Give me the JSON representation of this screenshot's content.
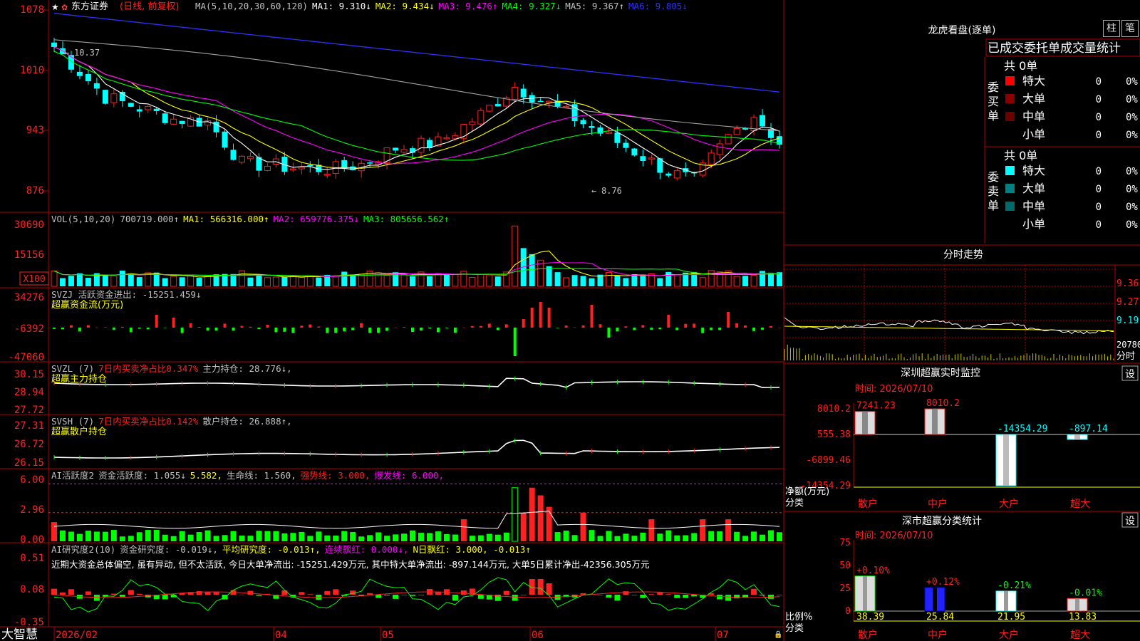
{
  "app": {
    "name": "大智慧"
  },
  "stock": {
    "name": "东方证券",
    "mode": "(日线, 前复权)"
  },
  "colors": {
    "up": "#ff2020",
    "down": "#00ffff",
    "frame": "#b00000",
    "ma1": "#ffffff",
    "ma2": "#ffff00",
    "ma3": "#ff00ff",
    "ma4": "#00ff00",
    "ma5": "#a0a0a0",
    "ma6": "#3030ff",
    "green": "#00ff00"
  },
  "price_panel": {
    "axis_ticks": [
      "1078",
      "1010",
      "943",
      "876"
    ],
    "legend": [
      {
        "t": "MA(5,10,20,30,60,120)",
        "c": "#c0c0c0"
      },
      {
        "t": "MA1: 9.310↓",
        "c": "#ffffff"
      },
      {
        "t": "MA2: 9.434↓",
        "c": "#ffff00"
      },
      {
        "t": "MA3: 9.476↑",
        "c": "#ff00ff"
      },
      {
        "t": "MA4: 9.327↓",
        "c": "#00ff00"
      },
      {
        "t": "MA5: 9.367↑",
        "c": "#c0c0c0"
      },
      {
        "t": "MA6: 9.805↓",
        "c": "#3030ff"
      }
    ],
    "hi_label": "10.37",
    "lo_label": "8.76"
  },
  "vol_panel": {
    "axis_ticks": [
      "30690",
      "15156"
    ],
    "unit": "X100",
    "legend": [
      {
        "t": "VOL(5,10,20)",
        "c": "#c0c0c0"
      },
      {
        "t": "700719.000↑",
        "c": "#c0c0c0"
      },
      {
        "t": "MA1: 566316.000↑",
        "c": "#ffff00"
      },
      {
        "t": "MA2: 659776.375↓",
        "c": "#ff00ff"
      },
      {
        "t": "MA3: 805656.562↑",
        "c": "#00ff00"
      }
    ]
  },
  "svzj_panel": {
    "axis_ticks": [
      "34276",
      "-6392",
      "-47060"
    ],
    "legend": [
      {
        "t": "SVZJ  活跃资金进出: -15251.459↓",
        "c": "#c0c0c0"
      }
    ],
    "sub": "超赢资金流(万元)"
  },
  "svzl_panel": {
    "axis_ticks": [
      "30.15",
      "28.94",
      "27.72"
    ],
    "legend": [
      {
        "t": "SVZL (7)",
        "c": "#c0c0c0"
      },
      {
        "t": "7日内买卖净占比0.347%",
        "c": "#ff2020"
      },
      {
        "t": "主力持仓: 28.776↓,",
        "c": "#c0c0c0"
      }
    ],
    "sub": "超赢主力持仓"
  },
  "svsh_panel": {
    "axis_ticks": [
      "27.31",
      "26.72",
      "26.15"
    ],
    "legend": [
      {
        "t": "SVSH (7)",
        "c": "#c0c0c0"
      },
      {
        "t": "7日内买卖净占比0.142%",
        "c": "#ff2020"
      },
      {
        "t": "散户持仓: 26.888↑,",
        "c": "#c0c0c0"
      }
    ],
    "sub": "超赢散户持仓"
  },
  "ai_active_panel": {
    "axis_ticks": [
      "6.00",
      "2.96",
      "0.00"
    ],
    "legend": [
      {
        "t": "AI活跃度2",
        "c": "#c0c0c0"
      },
      {
        "t": "资金活跃度: 1.055↓",
        "c": "#c0c0c0"
      },
      {
        "t": "5.582,",
        "c": "#ffff00"
      },
      {
        "t": "生命线: 1.560,",
        "c": "#c0c0c0"
      },
      {
        "t": "强势线: 3.000,",
        "c": "#ff2020"
      },
      {
        "t": "爆发线: 6.000,",
        "c": "#ff00ff"
      }
    ]
  },
  "ai_research_panel": {
    "axis_ticks": [
      "0.51",
      "0.08",
      "-0.35"
    ],
    "legend": [
      {
        "t": "AI研究度2(10)",
        "c": "#c0c0c0"
      },
      {
        "t": "资金研究度: -0.019↓,",
        "c": "#c0c0c0"
      },
      {
        "t": "平均研究度: -0.013↑,",
        "c": "#ffff00"
      },
      {
        "t": "连续飘红: 0.000↓,",
        "c": "#ff00ff"
      },
      {
        "t": "N日飘红: 3.000, -0.013↑",
        "c": "#ffff00"
      }
    ],
    "comment": "近期大资金总体偏空, 虽有异动, 但不太活跃, 今日大单净流出: -15251.429万元, 其中特大单净流出: -897.144万元, 大单5日累计净出-42356.305万元"
  },
  "date_axis": [
    "2026/02",
    "04",
    "05",
    "06",
    "07"
  ],
  "right": {
    "longhu_title": "龙虎看盘(逐单)",
    "btn_zhu": "柱",
    "btn_bi": "笔",
    "tab_header": "已成交委托单成交量统计",
    "buy": {
      "label": "委买单",
      "total": "共 0单",
      "rows": [
        {
          "name": "特大",
          "count": "0",
          "pct": "0%",
          "color": "#ff0000"
        },
        {
          "name": "大单",
          "count": "0",
          "pct": "0%",
          "color": "#8a0000"
        },
        {
          "name": "中单",
          "count": "0",
          "pct": "0%",
          "color": "#6a0000"
        },
        {
          "name": "小单",
          "count": "0",
          "pct": "0%",
          "color": "#000000"
        }
      ]
    },
    "sell": {
      "label": "委卖单",
      "total": "共 0单",
      "rows": [
        {
          "name": "特大",
          "count": "0",
          "pct": "0%",
          "color": "#00ffff"
        },
        {
          "name": "大单",
          "count": "0",
          "pct": "0%",
          "color": "#008080"
        },
        {
          "name": "中单",
          "count": "0",
          "pct": "0%",
          "color": "#006a6a"
        },
        {
          "name": "小单",
          "count": "0",
          "pct": "0%",
          "color": "#000000"
        }
      ]
    },
    "intraday": {
      "title": "分时走势",
      "prices": [
        "9.36",
        "9.27",
        "9.19"
      ],
      "vol_label": "20780",
      "sub": "分时"
    },
    "monitor": {
      "title": "深圳超赢实时监控",
      "set": "设",
      "time": "时间: 2026/07/10",
      "axis": [
        "8010.2",
        "555.38",
        "-6899.46",
        "-14354.29"
      ],
      "ylabel1": "净额(万元)",
      "ylabel2": "分类",
      "bars": [
        {
          "cat": "散户",
          "value": 7241.23,
          "label": "7241.23"
        },
        {
          "cat": "中户",
          "value": 8010.2,
          "label": "8010.2"
        },
        {
          "cat": "大户",
          "value": -14354.29,
          "label": "-14354.29"
        },
        {
          "cat": "超大",
          "value": -897.14,
          "label": "-897.14"
        }
      ]
    },
    "classify": {
      "title": "深市超赢分类统计",
      "set": "设",
      "time": "时间: 2026/07/10",
      "axis": [
        "75",
        "50",
        "25",
        "0"
      ],
      "ylabel1": "比例%",
      "ylabel2": "分类",
      "bars": [
        {
          "cat": "散户",
          "value": 38.39,
          "label": "38.39",
          "change": "+0.10%"
        },
        {
          "cat": "中户",
          "value": 25.84,
          "label": "25.84",
          "change": "+0.12%"
        },
        {
          "cat": "大户",
          "value": 21.95,
          "label": "21.95",
          "change": "-0.21%"
        },
        {
          "cat": "超大",
          "value": 13.83,
          "label": "13.83",
          "change": "-0.01%"
        }
      ]
    }
  }
}
